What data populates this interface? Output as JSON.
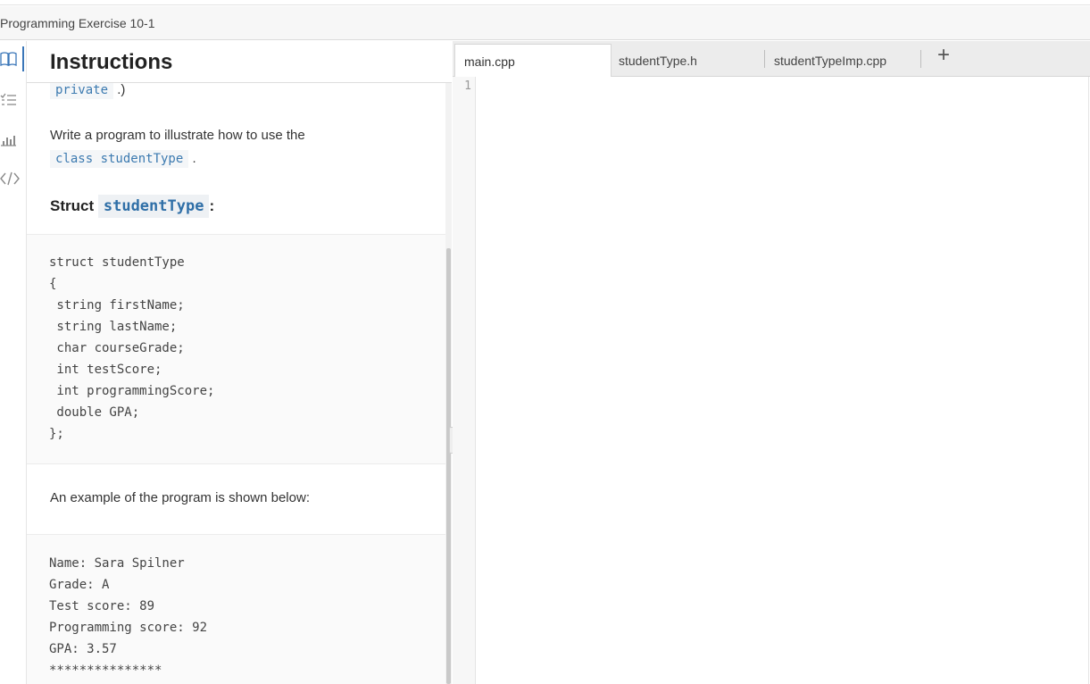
{
  "window": {
    "title": "Programming Exercise 10-1"
  },
  "rail": {
    "icons": [
      "book-icon",
      "checklist-icon",
      "chart-icon",
      "code-icon"
    ]
  },
  "instructions": {
    "header": "Instructions",
    "fragment_code": "private",
    "fragment_tail": ".)",
    "para1_text": "Write a program to illustrate how to use the",
    "para1_code": "class studentType",
    "para1_tail": ".",
    "heading_prefix": "Struct",
    "heading_code": "studentType",
    "heading_suffix": ":",
    "struct_code": [
      "struct studentType",
      "{",
      " string firstName;",
      " string lastName;",
      " char courseGrade;",
      " int testScore;",
      " int programmingScore;",
      " double GPA;",
      "};"
    ],
    "para2_text": "An example of the program is shown below:",
    "example_output": [
      "Name: Sara Spilner",
      "Grade: A",
      "Test score: 89",
      "Programming score: 92",
      "GPA: 3.57",
      "***************"
    ]
  },
  "editor": {
    "tabs": [
      "main.cpp",
      "studentType.h",
      "studentTypeImp.cpp"
    ],
    "active_tab": "main.cpp",
    "add_tab_label": "+",
    "line_numbers": [
      "1"
    ]
  }
}
